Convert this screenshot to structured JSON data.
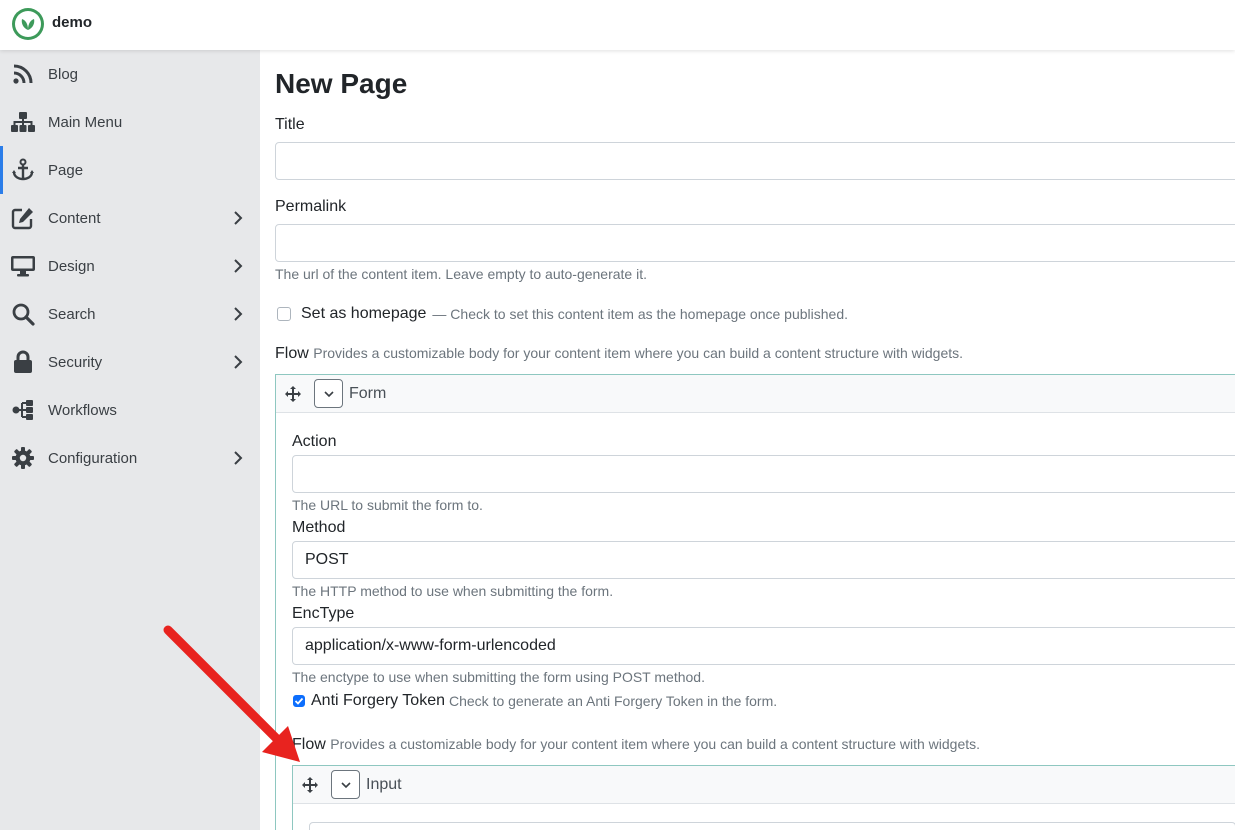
{
  "app": {
    "brand": "demo"
  },
  "sidebar": {
    "items": [
      {
        "label": "Blog",
        "icon": "rss-icon",
        "has_children": false,
        "active": false
      },
      {
        "label": "Main Menu",
        "icon": "sitemap-icon",
        "has_children": false,
        "active": false
      },
      {
        "label": "Page",
        "icon": "anchor-icon",
        "has_children": false,
        "active": true
      },
      {
        "label": "Content",
        "icon": "edit-icon",
        "has_children": true,
        "active": false
      },
      {
        "label": "Design",
        "icon": "monitor-icon",
        "has_children": true,
        "active": false
      },
      {
        "label": "Search",
        "icon": "search-icon",
        "has_children": true,
        "active": false
      },
      {
        "label": "Security",
        "icon": "lock-icon",
        "has_children": true,
        "active": false
      },
      {
        "label": "Workflows",
        "icon": "workflow-icon",
        "has_children": false,
        "active": false
      },
      {
        "label": "Configuration",
        "icon": "gear-icon",
        "has_children": true,
        "active": false
      }
    ]
  },
  "main": {
    "title": "New Page",
    "title_field": {
      "label": "Title",
      "value": ""
    },
    "permalink_field": {
      "label": "Permalink",
      "value": "",
      "hint": "The url of the content item. Leave empty to auto-generate it."
    },
    "homepage": {
      "label": "Set as homepage",
      "hint": "— Check to set this content item as the homepage once published.",
      "checked": false
    },
    "flow": {
      "label": "Flow",
      "hint": "Provides a customizable body for your content item where you can build a content structure with widgets."
    },
    "form_widget": {
      "title": "Form",
      "action": {
        "label": "Action",
        "value": "",
        "hint": "The URL to submit the form to."
      },
      "method": {
        "label": "Method",
        "value": "POST",
        "hint": "The HTTP method to use when submitting the form."
      },
      "enctype": {
        "label": "EncType",
        "value": "application/x-www-form-urlencoded",
        "hint": "The enctype to use when submitting the form using POST method."
      },
      "antiforgery": {
        "label": "Anti Forgery Token",
        "hint": "Check to generate an Anti Forgery Token in the form.",
        "checked": true
      },
      "flow": {
        "label": "Flow",
        "hint": "Provides a customizable body for your content item where you can build a content structure with widgets."
      },
      "input_widget": {
        "title": "Input"
      }
    }
  },
  "colors": {
    "accent": "#2b7de9",
    "brand": "#3d9a5a",
    "arrow": "#e8231f",
    "checkbox": "#0d6efd"
  }
}
